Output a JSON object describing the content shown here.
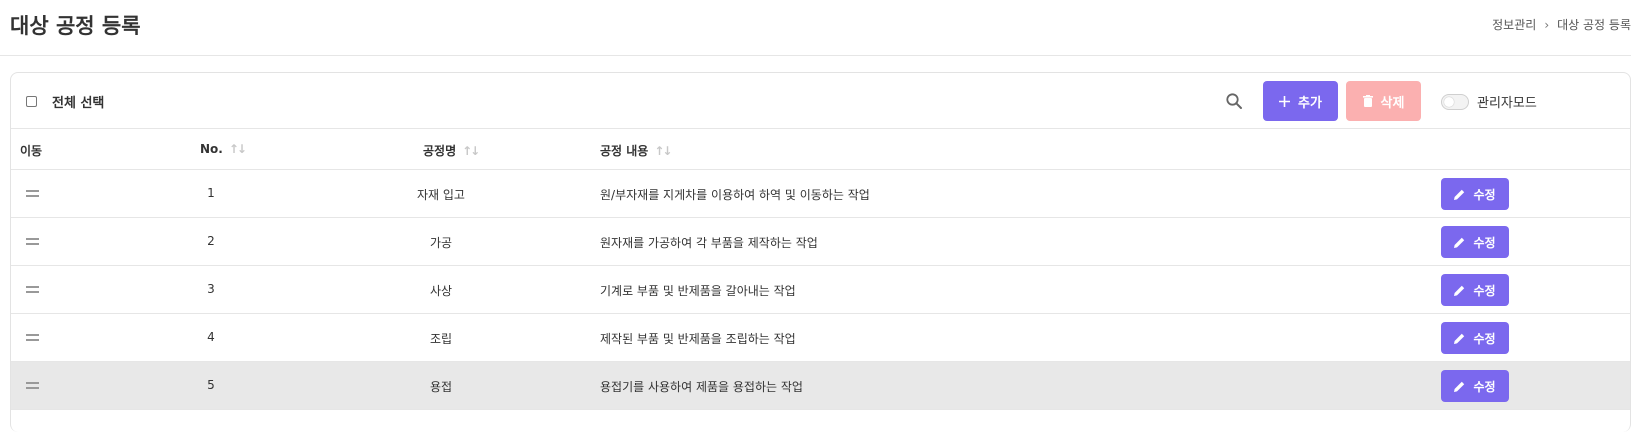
{
  "header": {
    "title": "대상 공정 등록",
    "breadcrumb": [
      "정보관리",
      "대상 공정 등록"
    ],
    "breadcrumb_sep": "›"
  },
  "toolbar": {
    "select_all_label": "전체 선택",
    "search_icon": "search-icon",
    "add_label": "추가",
    "delete_label": "삭제",
    "admin_mode_label": "관리자모드",
    "admin_mode_on": false
  },
  "table": {
    "columns": {
      "move": "이동",
      "no": "No.",
      "name": "공정명",
      "desc": "공정 내용"
    },
    "sort_icon": "↑↓",
    "edit_label": "수정",
    "rows": [
      {
        "no": "1",
        "name": "자재 입고",
        "desc": "원/부자재를 지게차를 이용하여 하역 및 이동하는 작업"
      },
      {
        "no": "2",
        "name": "가공",
        "desc": "원자재를 가공하여 각 부품을 제작하는 작업"
      },
      {
        "no": "3",
        "name": "사상",
        "desc": "기계로 부품 및 반제품을 갈아내는 작업"
      },
      {
        "no": "4",
        "name": "조립",
        "desc": "제작된 부품 및 반제품을 조립하는 작업"
      },
      {
        "no": "5",
        "name": "용접",
        "desc": "용접기를 사용하여 제품을 용접하는 작업"
      }
    ]
  },
  "colors": {
    "accent": "#7b68ee",
    "delete_disabled": "#fbb0b0",
    "row_highlight": "#e8e8e8"
  }
}
